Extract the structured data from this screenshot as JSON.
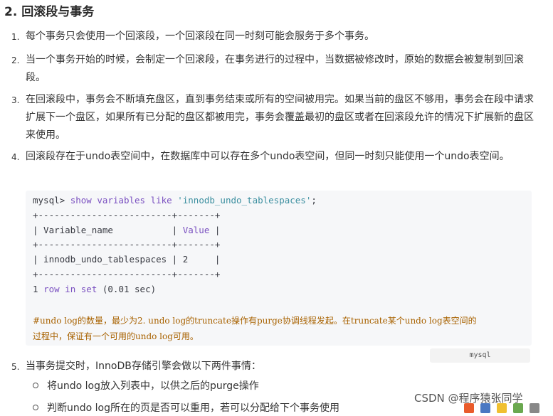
{
  "heading": "2. 回滚段与事务",
  "items": [
    {
      "num": "1.",
      "text": "每个事务只会使用一个回滚段，一个回滚段在同一时刻可能会服务于多个事务。"
    },
    {
      "num": "2.",
      "text": "当一个事务开始的时候，会制定一个回滚段，在事务进行的过程中，当数据被修改时，原始的数据会被复制到回滚段。"
    },
    {
      "num": "3.",
      "text": "在回滚段中，事务会不断填充盘区，直到事务结束或所有的空间被用完。如果当前的盘区不够用，事务会在段中请求扩展下一个盘区，如果所有已分配的盘区都被用完，事务会覆盖最初的盘区或者在回滚段允许的情况下扩展新的盘区来使用。"
    },
    {
      "num": "4.",
      "text": "回滚段存在于undo表空间中，在数据库中可以存在多个undo表空间，但同一时刻只能使用一个undo表空间。"
    },
    {
      "num": "5.",
      "text": "当事务提交时，InnoDB存储引擎会做以下两件事情："
    }
  ],
  "code": {
    "prompt": "mysql>",
    "command_kw": "show variables like",
    "command_str": "'innodb_undo_tablespaces'",
    "command_end": ";",
    "border": "+-------------------------+-------+",
    "header_row_a": "| Variable_name           | ",
    "header_value": "Value",
    "header_row_b": " |",
    "data_row": "| innodb_undo_tablespaces | 2     |",
    "result_a": "1 ",
    "result_kw1": "row",
    "result_kw2": "in",
    "result_kw3": "set",
    "result_b": " (0.01 sec)",
    "comment_line1": "#undo log的数量，最少为2. undo log的truncate操作有purge协调线程发起。在truncate某个undo log表空间的",
    "comment_line2": "过程中，保证有一个可用的undo log可用。",
    "language": "mysql"
  },
  "subitems": [
    "将undo log放入列表中，以供之后的purge操作",
    "判断undo log所在的页是否可以重用，若可以分配给下个事务使用"
  ],
  "watermark": "CSDN @程序猿张同学"
}
